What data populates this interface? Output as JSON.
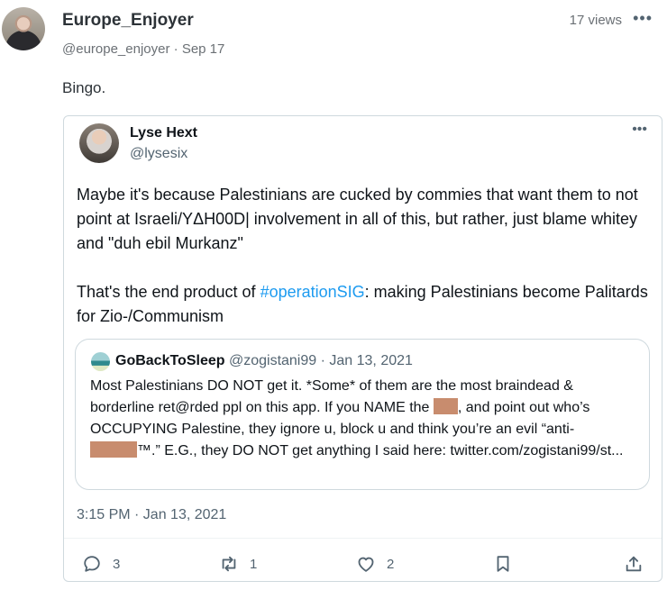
{
  "post": {
    "author_name": "Europe_Enjoyer",
    "author_handle": "@europe_enjoyer",
    "date": "Sep 17",
    "views": "17 views",
    "more": "•••",
    "text": "Bingo."
  },
  "embed": {
    "author_name": "Lyse Hext",
    "author_handle": "@lysesix",
    "more": "•••",
    "paragraph1": "Maybe it's because Palestinians are cucked by commies that want them to not point at Israeli/YΔH00D| involvement in all of this, but rather, just blame whitey and \"duh ebil Murkanz\"",
    "paragraph2_before": "That's the end product of ",
    "hashtag": "#operationSIG",
    "paragraph2_after": ": making Palestinians become Palitards for Zio-/Communism",
    "quote": {
      "author_name": "GoBackToSleep",
      "author_handle": "@zogistani99",
      "date": "Jan 13, 2021",
      "text_part1": "Most Palestinians DO NOT get it. *Some* of them are the most braindead & borderline ret@rded ppl on this app. If you NAME the ",
      "text_part2": ", and point out who’s OCCUPYING Palestine, they ignore u, block u and think you’re an evil “anti-",
      "text_part3": "™.” E.G., they DO NOT get anything I said here: twitter.com/zogistani99/st..."
    },
    "timestamp": "3:15 PM · Jan 13, 2021",
    "actions": {
      "replies": "3",
      "retweets": "1",
      "likes": "2"
    }
  }
}
